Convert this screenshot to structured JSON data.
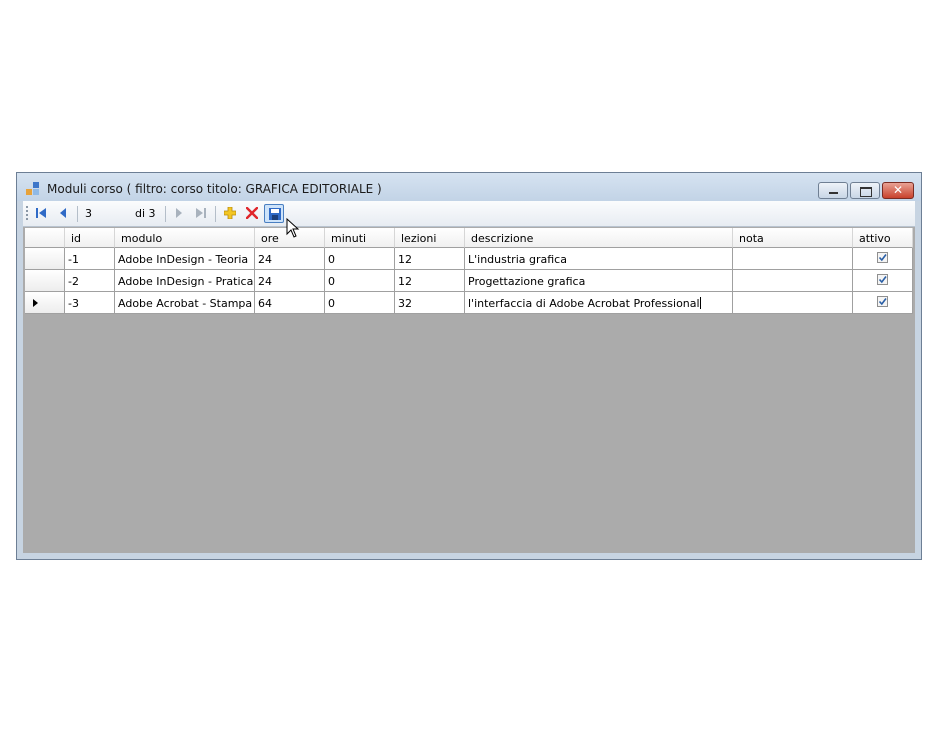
{
  "window": {
    "title": "Moduli corso ( filtro: corso titolo: GRAFICA EDITORIALE )",
    "buttons": [
      "minimize",
      "maximize",
      "close"
    ]
  },
  "navigator": {
    "position": "3",
    "count_label": "di 3",
    "icons": {
      "first": "first-record-icon",
      "prev": "previous-record-icon",
      "next": "next-record-icon",
      "last": "last-record-icon",
      "add": "add-new-icon",
      "delete": "delete-icon",
      "save": "save-icon"
    }
  },
  "grid": {
    "columns": [
      "id",
      "modulo",
      "ore",
      "minuti",
      "lezioni",
      "descrizione",
      "nota",
      "attivo"
    ],
    "rows": [
      {
        "id": "-1",
        "modulo": "Adobe InDesign - Teoria",
        "ore": "24",
        "minuti": "0",
        "lezioni": "12",
        "descrizione": "L'industria grafica",
        "nota": "",
        "attivo": true
      },
      {
        "id": "-2",
        "modulo": "Adobe InDesign - Pratica",
        "ore": "24",
        "minuti": "0",
        "lezioni": "12",
        "descrizione": "Progettazione grafica",
        "nota": "",
        "attivo": true
      },
      {
        "id": "-3",
        "modulo": "Adobe Acrobat - Stampa",
        "ore": "64",
        "minuti": "0",
        "lezioni": "32",
        "descrizione": "l'interfaccia di Adobe Acrobat Professional",
        "nota": "",
        "attivo": true
      }
    ],
    "current_row": 2
  },
  "colors": {
    "titlebar": "#c7d4e2",
    "grid_background": "#ababab",
    "accent": "#2f6ac6",
    "delete": "#e0262b",
    "add": "#e8b818"
  }
}
